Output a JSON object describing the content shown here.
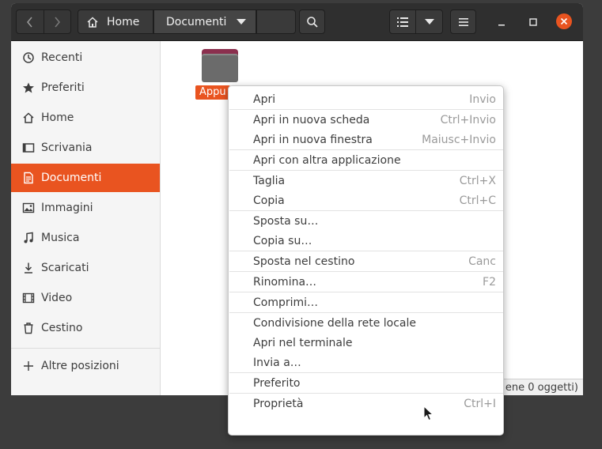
{
  "header": {
    "path": {
      "home_label": "Home",
      "current_label": "Documenti"
    }
  },
  "sidebar": {
    "items": [
      {
        "label": "Recenti",
        "icon": "clock-icon"
      },
      {
        "label": "Preferiti",
        "icon": "star-icon"
      },
      {
        "label": "Home",
        "icon": "home-icon"
      },
      {
        "label": "Scrivania",
        "icon": "desktop-icon"
      },
      {
        "label": "Documenti",
        "icon": "document-icon",
        "active": true
      },
      {
        "label": "Immagini",
        "icon": "image-icon"
      },
      {
        "label": "Musica",
        "icon": "music-icon"
      },
      {
        "label": "Scaricati",
        "icon": "download-icon"
      },
      {
        "label": "Video",
        "icon": "video-icon"
      },
      {
        "label": "Cestino",
        "icon": "trash-icon"
      },
      {
        "label": "Altre posizioni",
        "icon": "plus-icon"
      }
    ]
  },
  "content": {
    "folder_label": "Appu",
    "status_text": "ene 0 oggetti)"
  },
  "context_menu": {
    "items": [
      {
        "label": "Apri",
        "accel": "Invio"
      },
      {
        "label": "Apri in nuova scheda",
        "accel": "Ctrl+Invio"
      },
      {
        "label": "Apri in nuova finestra",
        "accel": "Maiusc+Invio"
      },
      {
        "label": "Apri con altra applicazione",
        "accel": ""
      },
      {
        "label": "Taglia",
        "accel": "Ctrl+X"
      },
      {
        "label": "Copia",
        "accel": "Ctrl+C"
      },
      {
        "label": "Sposta su…",
        "accel": ""
      },
      {
        "label": "Copia su…",
        "accel": ""
      },
      {
        "label": "Sposta nel cestino",
        "accel": "Canc"
      },
      {
        "label": "Rinomina…",
        "accel": "F2"
      },
      {
        "label": "Comprimi…",
        "accel": ""
      },
      {
        "label": "Condivisione della rete locale",
        "accel": ""
      },
      {
        "label": "Apri nel terminale",
        "accel": ""
      },
      {
        "label": "Invia a…",
        "accel": ""
      },
      {
        "label": "Preferito",
        "accel": ""
      },
      {
        "label": "Proprietà",
        "accel": "Ctrl+I"
      }
    ]
  },
  "colors": {
    "accent": "#e95420",
    "headerbar": "#2f2f2f",
    "close_button": "#e95420"
  }
}
